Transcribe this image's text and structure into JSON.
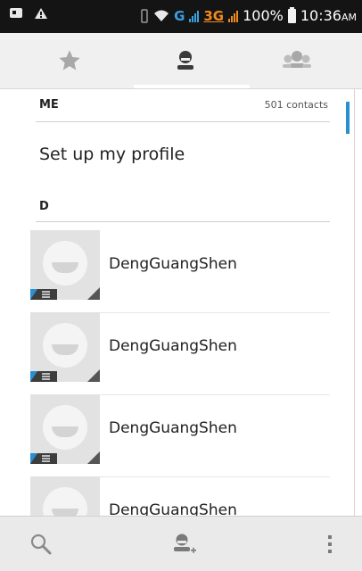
{
  "status_bar": {
    "network_g": "G",
    "network_3g": "3G",
    "battery_percent": "100%",
    "time": "10:36",
    "ampm": "AM"
  },
  "tabs": [
    {
      "icon": "star-icon",
      "active": false
    },
    {
      "icon": "person-icon",
      "active": true
    },
    {
      "icon": "group-icon",
      "active": false
    }
  ],
  "me_section": {
    "label": "ME",
    "count": "501 contacts",
    "setup_profile": "Set up my profile"
  },
  "d_section": {
    "label": "D"
  },
  "contacts": [
    {
      "name": "DengGuangShen"
    },
    {
      "name": "DengGuangShen"
    },
    {
      "name": "DengGuangShen"
    },
    {
      "name": "DengGuangShen"
    }
  ],
  "bottom_bar": {
    "search": "search-icon",
    "add_contact": "add-contact-icon",
    "menu": "overflow-menu-icon"
  },
  "colors": {
    "accent": "#2a8fd0",
    "status_bar": "#141414",
    "signal_3g": "#f08a1e"
  }
}
